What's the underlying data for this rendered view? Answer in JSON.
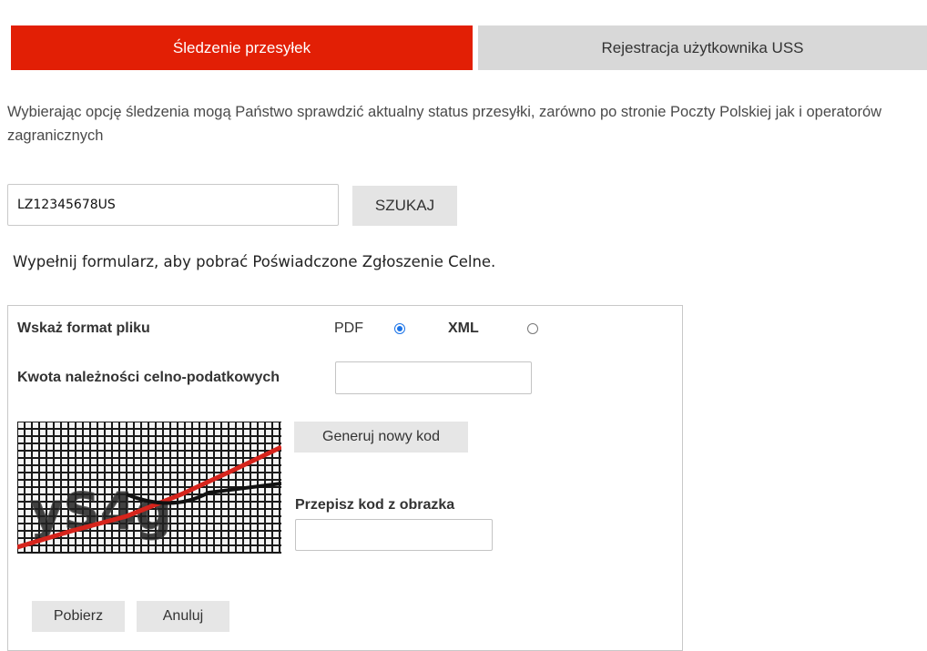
{
  "tabs": {
    "tracking": "Śledzenie przesyłek",
    "registration": "Rejestracja użytkownika USS"
  },
  "description": "Wybierając opcję śledzenia mogą Państwo sprawdzić aktualny status przesyłki, zarówno po stronie Poczty Polskiej jak i operatorów zagranicznych",
  "search": {
    "value": "LZ12345678US",
    "button": "SZUKAJ"
  },
  "form_hint": "Wypełnij formularz, aby pobrać Poświadczone Zgłoszenie Celne.",
  "form": {
    "format_label": "Wskaż format pliku",
    "format_options": [
      "PDF",
      "XML"
    ],
    "selected_format": "PDF",
    "amount_label": "Kwota należności celno-podatkowych",
    "amount_value": "",
    "new_code_button": "Generuj nowy kod",
    "captcha_label": "Przepisz kod z obrazka",
    "captcha_value": "",
    "captcha_text": "yS4g",
    "download_button": "Pobierz",
    "cancel_button": "Anuluj"
  },
  "colors": {
    "accent": "#e21f05",
    "inactive_tab": "#d8d8d8",
    "radio_selected": "#1a73e8"
  }
}
